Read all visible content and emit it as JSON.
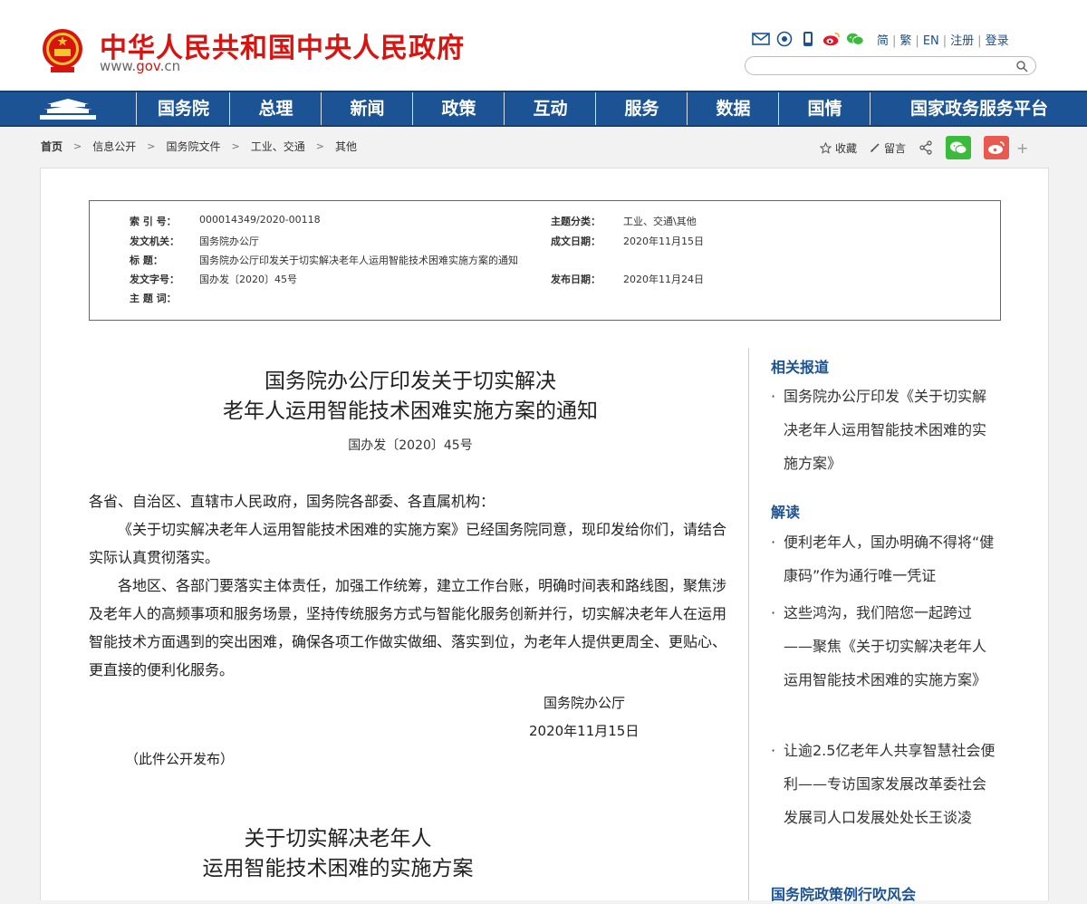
{
  "header": {
    "site_title": "中华人民共和国中央人民政府",
    "site_url_prefix": "www.",
    "site_url_gov": "gov",
    "site_url_suffix": ".cn",
    "tool_icons": [
      "mail-icon",
      "app-icon",
      "mobile-icon",
      "weibo-icon",
      "wechat-icon"
    ],
    "lang_links": [
      "简",
      "繁",
      "EN",
      "注册",
      "登录"
    ],
    "search_placeholder": ""
  },
  "nav": {
    "items": [
      "国务院",
      "总理",
      "新闻",
      "政策",
      "互动",
      "服务",
      "数据",
      "国情",
      "国家政务服务平台"
    ]
  },
  "breadcrumb": {
    "items": [
      "首页",
      "信息公开",
      "国务院文件",
      "工业、交通",
      "其他"
    ]
  },
  "share": {
    "favorite_label": "收藏",
    "print_label": "留言",
    "plus": "+"
  },
  "meta": {
    "index_no_key": "索  引  号：",
    "index_no_val": "000014349/2020-00118",
    "topic_key": "主题分类：",
    "topic_val": "工业、交通\\其他",
    "issuer_key": "发文机关：",
    "issuer_val": "国务院办公厅",
    "date_key": "成文日期：",
    "date_val": "2020年11月15日",
    "title_key": "标      题：",
    "title_val": "国务院办公厅印发关于切实解决老年人运用智能技术困难实施方案的通知",
    "docno_key": "发文字号：",
    "docno_val": "国办发〔2020〕45号",
    "pubdate_key": "发布日期：",
    "pubdate_val": "2020年11月24日",
    "subject_key": "主  题  词："
  },
  "article": {
    "title_line1": "国务院办公厅印发关于切实解决",
    "title_line2": "老年人运用智能技术困难实施方案的通知",
    "doc_no": "国办发〔2020〕45号",
    "para1": "各省、自治区、直辖市人民政府，国务院各部委、各直属机构：",
    "para2": "《关于切实解决老年人运用智能技术困难的实施方案》已经国务院同意，现印发给你们，请结合实际认真贯彻落实。",
    "para3": "各地区、各部门要落实主体责任，加强工作统筹，建立工作台账，明确时间表和路线图，聚焦涉及老年人的高频事项和服务场景，坚持传统服务方式与智能化服务创新并行，切实解决老年人在运用智能技术方面遇到的突出困难，确保各项工作做实做细、落实到位，为老年人提供更周全、更贴心、更直接的便利化服务。",
    "sign_org": "国务院办公厅",
    "sign_date": "2020年11月15日",
    "public_note": "（此件公开发布）",
    "plan_title_line1": "关于切实解决老年人",
    "plan_title_line2": "运用智能技术困难的实施方案"
  },
  "sidebar": {
    "related_head": "相关报道",
    "related_items": [
      "国务院办公厅印发《关于切实解决老年人运用智能技术困难的实施方案》"
    ],
    "interpret_head": "解读",
    "interpret_items": [
      "便利老年人，国办明确不得将“健康码”作为通行唯一凭证",
      "这些鸿沟，我们陪您一起跨过——聚焦《关于切实解决老年人运用智能技术困难的实施方案》",
      "让逾2.5亿老年人共享智慧社会便利——专访国家发展改革委社会发展司人口发展处处长王谈凌"
    ],
    "bottom_head": "国务院政策例行吹风会"
  }
}
